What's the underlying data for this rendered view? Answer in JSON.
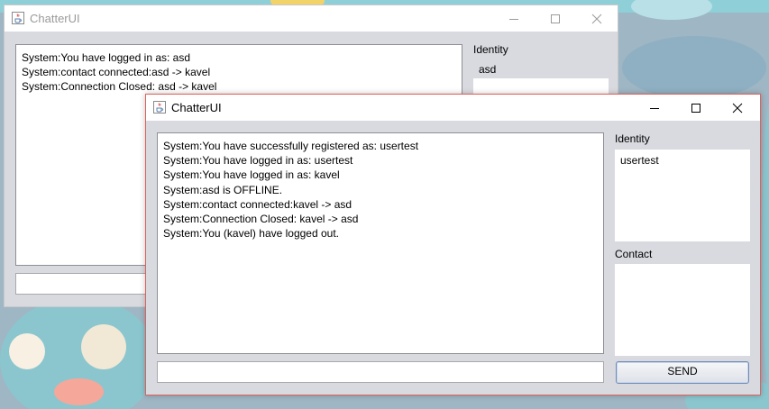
{
  "windows": [
    {
      "title": "ChatterUI",
      "chat_lines": [
        "System:You have logged in as: asd",
        "System:contact connected:asd -> kavel",
        "System:Connection Closed: asd -> kavel"
      ],
      "identity_label": "Identity",
      "identity_items": [
        "asd"
      ],
      "message_value": ""
    },
    {
      "title": "ChatterUI",
      "chat_lines": [
        "System:You have successfully registered as: usertest",
        "System:You have logged in as: usertest",
        "System:You have logged in as: kavel",
        "System:asd is OFFLINE.",
        "System:contact connected:kavel -> asd",
        "System:Connection Closed: kavel -> asd",
        "System:You (kavel) have logged out."
      ],
      "identity_label": "Identity",
      "identity_items": [
        "usertest"
      ],
      "contact_label": "Contact",
      "contact_items": [],
      "message_value": "",
      "send_label": "SEND"
    }
  ],
  "icons": {
    "app": "java-cup-icon",
    "minimize": "minimize-icon",
    "maximize": "maximize-icon",
    "close": "close-icon"
  },
  "colors": {
    "active_border": "#e0615c",
    "panel_bg": "#d9dae0",
    "inactive_title": "#9a9a9a"
  }
}
